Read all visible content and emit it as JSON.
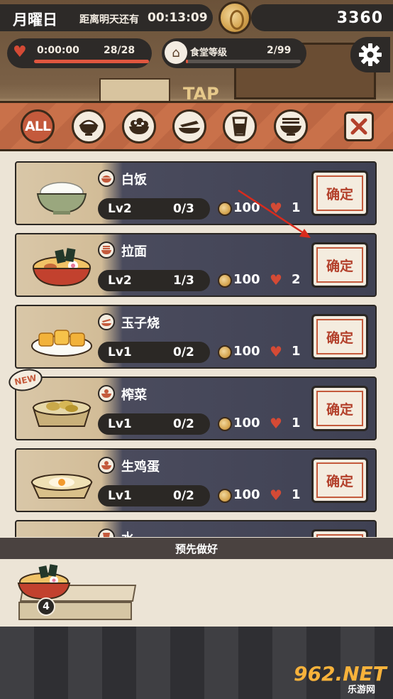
{
  "hud": {
    "day": "月曜日",
    "until_label": "距离明天还有",
    "timer": "00:13:09",
    "coins": "3360",
    "heart_time": "0:00:00",
    "heart_count": "28/28",
    "heart_fill": 1.0,
    "level_label": "食堂等级",
    "level_count": "2/99",
    "level_fill": 0.02
  },
  "scene": {
    "tap_text": "TAP"
  },
  "categories": [
    {
      "id": "all",
      "label": "ALL",
      "icon": "all-icon",
      "active": true
    },
    {
      "id": "rice",
      "icon": "rice-bowl-icon"
    },
    {
      "id": "salad",
      "icon": "salad-icon"
    },
    {
      "id": "plate",
      "icon": "plate-icon"
    },
    {
      "id": "drink",
      "icon": "cup-icon"
    },
    {
      "id": "noodle",
      "icon": "noodle-bowl-icon"
    }
  ],
  "dishes": [
    {
      "name": "白饭",
      "level": "Lv2",
      "progress": "0/3",
      "price": "100",
      "hearts": "1",
      "confirm": "确定",
      "icon": "rice-bowl-icon"
    },
    {
      "name": "拉面",
      "level": "Lv2",
      "progress": "1/3",
      "price": "100",
      "hearts": "2",
      "confirm": "确定",
      "icon": "noodle-bowl-icon"
    },
    {
      "name": "玉子烧",
      "level": "Lv1",
      "progress": "0/2",
      "price": "100",
      "hearts": "1",
      "confirm": "确定",
      "icon": "plate-icon"
    },
    {
      "name": "榨菜",
      "level": "Lv1",
      "progress": "0/2",
      "price": "100",
      "hearts": "1",
      "confirm": "确定",
      "icon": "bowl-icon",
      "new": "NEW"
    },
    {
      "name": "生鸡蛋",
      "level": "Lv1",
      "progress": "0/2",
      "price": "100",
      "hearts": "1",
      "confirm": "确定",
      "icon": "bowl-icon"
    },
    {
      "name": "水",
      "level": "",
      "progress": "",
      "price": "",
      "hearts": "",
      "confirm": "",
      "icon": "cup-icon"
    }
  ],
  "prepared": {
    "title": "预先做好",
    "count": "4"
  },
  "watermark": {
    "main": "962.NET",
    "sub": "乐游网"
  },
  "colors": {
    "accent": "#c45a3c",
    "panel": "#ece4d6",
    "card": "#3f4153",
    "heart": "#d44a35",
    "coin": "#d6a652"
  }
}
